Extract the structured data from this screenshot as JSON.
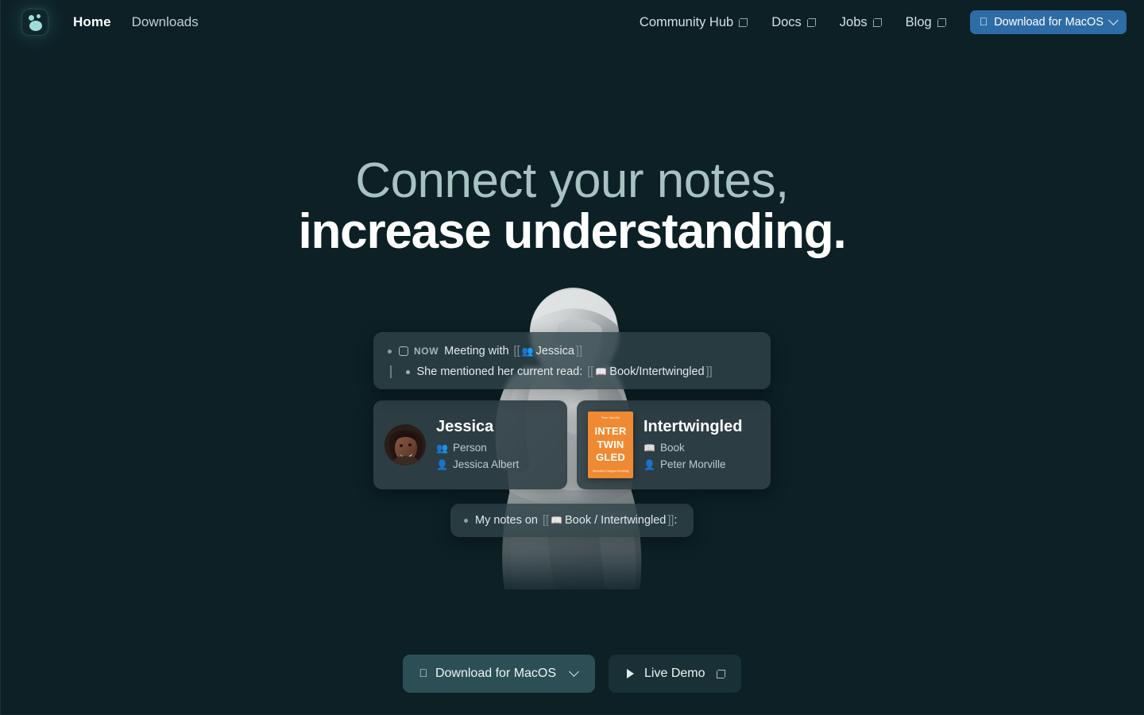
{
  "theme": {
    "background": "#0c2026",
    "accent_blue": "#2e6ca6",
    "cta_primary": "#2c4f56",
    "cta_secondary": "#193136",
    "book_orange": "#ef8a33",
    "headline_muted": "#a8c2c2"
  },
  "header": {
    "logo_name": "logseq-logo",
    "left_links": [
      {
        "label": "Home",
        "active": true
      },
      {
        "label": "Downloads",
        "active": false
      }
    ],
    "right_links": [
      {
        "label": "Community Hub",
        "external": true
      },
      {
        "label": "Docs",
        "external": true
      },
      {
        "label": "Jobs",
        "external": true
      },
      {
        "label": "Blog",
        "external": true
      }
    ],
    "download_button": {
      "label": "Download for MacOS",
      "icon": "apple-icon",
      "chevron": "chevron-down-icon"
    }
  },
  "hero": {
    "headline_line1": "Connect your notes,",
    "headline_line2": "increase understanding.",
    "illustration": "the-thinker-statue"
  },
  "graph": {
    "note_card": {
      "now_tag": "NOW",
      "line1_text": "Meeting with",
      "line1_ref_icon": "people-icon",
      "line1_ref": "Jessica",
      "line2_text": "She mentioned her current read:",
      "line2_ref_icon": "book-icon",
      "line2_ref": "Book/Intertwingled",
      "bracket_open": "[[",
      "bracket_close": "]]"
    },
    "entities": [
      {
        "id": "jessica",
        "title": "Jessica",
        "thumb": "avatar-photo",
        "meta": [
          {
            "icon": "people-icon",
            "glyph": "👥",
            "text": "Person"
          },
          {
            "icon": "person-icon",
            "glyph": "👤",
            "text": "Jessica Albert"
          }
        ]
      },
      {
        "id": "intertwingled",
        "title": "Intertwingled",
        "thumb": "book-cover",
        "cover": {
          "top_line": "Peter Morville",
          "title_lines": "INTER\nTWIN\nGLED",
          "title_line1": "INTER",
          "title_line2": "TWIN",
          "title_line3": "GLED",
          "sub_line": "Information Changes Everything"
        },
        "meta": [
          {
            "icon": "book-icon",
            "glyph": "📖",
            "text": "Book"
          },
          {
            "icon": "person-icon",
            "glyph": "👤",
            "text": "Peter Morville"
          }
        ]
      }
    ],
    "bottom_note": {
      "text": "My notes on",
      "ref_icon": "book-icon",
      "ref": "Book / Intertwingled",
      "bracket_open": "[[",
      "bracket_close": "]]",
      "trailing": ":"
    }
  },
  "cta": {
    "primary": {
      "label": "Download for MacOS",
      "icon": "apple-icon",
      "chevron": "chevron-down-icon"
    },
    "secondary": {
      "label": "Live Demo",
      "icon": "play-icon",
      "external_icon": "external-link-icon"
    }
  }
}
